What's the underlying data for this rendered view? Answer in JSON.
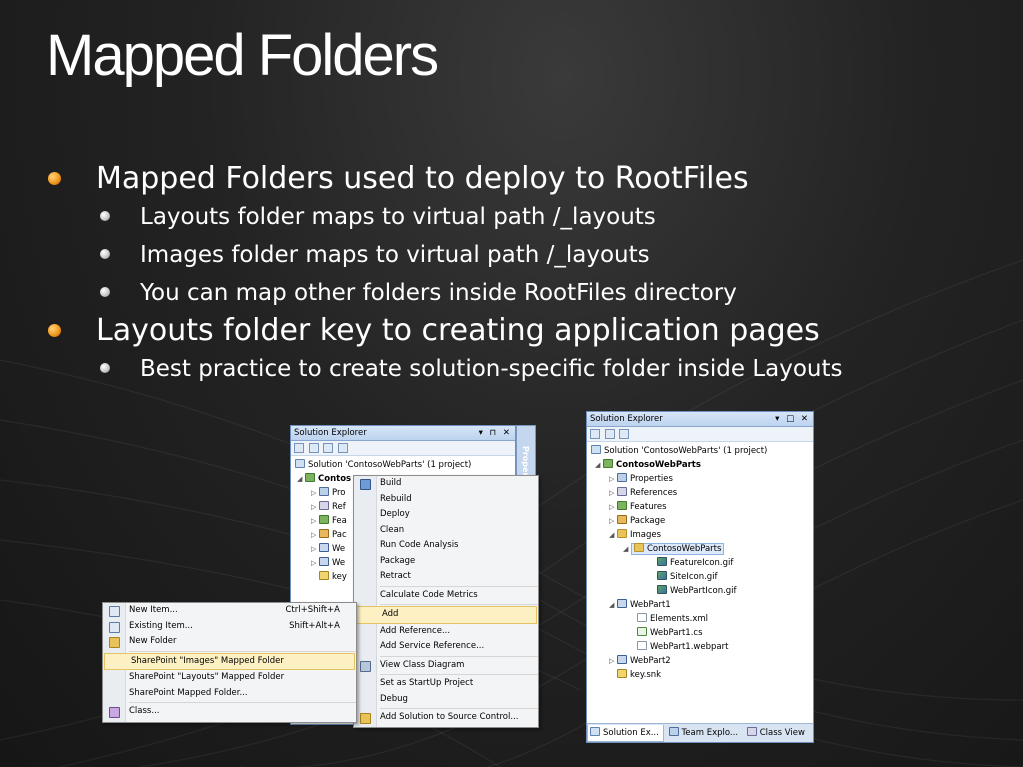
{
  "slide": {
    "title": "Mapped Folders",
    "bullets": [
      {
        "text": "Mapped Folders used to deploy to RootFiles",
        "level": 1
      },
      {
        "text": "Layouts folder maps to virtual path /_layouts",
        "level": 2
      },
      {
        "text": "Images folder maps to virtual path /_layouts",
        "level": 2
      },
      {
        "text": "You can map other folders inside RootFiles directory",
        "level": 2
      },
      {
        "text": "Layouts folder key to creating application pages",
        "level": 1
      },
      {
        "text": "Best practice to create solution-specific folder inside Layouts",
        "level": 2
      }
    ]
  },
  "left_solution_explorer": {
    "title": "Solution Explorer",
    "controls": "▾ ⊓ ✕",
    "solution_label": "Solution 'ContosoWebParts' (1 project)",
    "items": [
      "Contos",
      "Pro",
      "Ref",
      "Fea",
      "Pac",
      "We",
      "We",
      "key"
    ],
    "properties_tab": "Properties"
  },
  "context_menu": {
    "items": [
      {
        "label": "Build",
        "shortcut": ""
      },
      {
        "label": "Rebuild",
        "shortcut": ""
      },
      {
        "label": "Deploy",
        "shortcut": ""
      },
      {
        "label": "Clean",
        "shortcut": ""
      },
      {
        "label": "Run Code Analysis",
        "shortcut": ""
      },
      {
        "label": "Package",
        "shortcut": ""
      },
      {
        "label": "Retract",
        "shortcut": ""
      },
      {
        "label": "Calculate Code Metrics",
        "shortcut": ""
      },
      {
        "label": "Add",
        "shortcut": ""
      },
      {
        "label": "Add Reference...",
        "shortcut": ""
      },
      {
        "label": "Add Service Reference...",
        "shortcut": ""
      },
      {
        "label": "View Class Diagram",
        "shortcut": ""
      },
      {
        "label": "Set as StartUp Project",
        "shortcut": ""
      },
      {
        "label": "Debug",
        "shortcut": ""
      },
      {
        "label": "Add Solution to Source Control...",
        "shortcut": ""
      }
    ]
  },
  "add_submenu": {
    "items": [
      {
        "label": "New Item...",
        "shortcut": "Ctrl+Shift+A"
      },
      {
        "label": "Existing Item...",
        "shortcut": "Shift+Alt+A"
      },
      {
        "label": "New Folder",
        "shortcut": ""
      },
      {
        "label": "SharePoint \"Images\" Mapped Folder",
        "shortcut": ""
      },
      {
        "label": "SharePoint \"Layouts\" Mapped Folder",
        "shortcut": ""
      },
      {
        "label": "SharePoint Mapped Folder...",
        "shortcut": ""
      },
      {
        "label": "Class...",
        "shortcut": ""
      }
    ]
  },
  "right_solution_explorer": {
    "title": "Solution Explorer",
    "controls": "▾ □ ✕",
    "solution_label": "Solution 'ContosoWebParts' (1 project)",
    "project": "ContosoWebParts",
    "properties": "Properties",
    "references": "References",
    "features": "Features",
    "package": "Package",
    "images": "Images",
    "images_sub": "ContosoWebParts",
    "file1": "FeatureIcon.gif",
    "file2": "SiteIcon.gif",
    "file3": "WebPartIcon.gif",
    "webpart1": "WebPart1",
    "elements": "Elements.xml",
    "webpart1_cs": "WebPart1.cs",
    "webpart1_webpart": "WebPart1.webpart",
    "webpart2": "WebPart2",
    "key": "key.snk",
    "tabs": [
      "Solution Ex...",
      "Team Explo...",
      "Class View"
    ]
  }
}
